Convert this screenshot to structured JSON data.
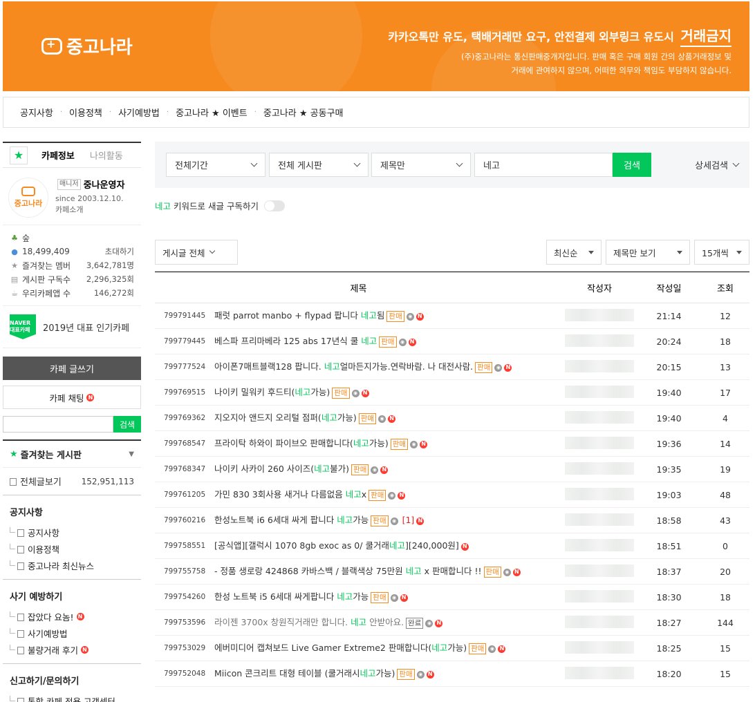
{
  "banner": {
    "logo": "중고나라",
    "warning_prefix": "카카오톡만 유도, 택배거래만 요구, 안전결제 외부링크 유도시",
    "warning_strong": "거래금지",
    "notice_line1": "(주)중고나라는 통신판매중개자입니다. 판매 혹은 구매 회원 간의 상품거래정보 및",
    "notice_line2": "거래에 관여하지 않으며, 어떠한 의무와 책임도 부담하지 않습니다."
  },
  "toplinks": [
    "공지사항",
    "이용정책",
    "사기예방법",
    "중고나라 ★ 이벤트",
    "중고나라 ★ 공동구매"
  ],
  "sidebar": {
    "tab_info": "카페정보",
    "tab_activity": "나의활동",
    "manager_tag": "매니저",
    "manager_name": "중나운영자",
    "since": "since 2003.12.10.",
    "intro": "카페소개",
    "profile_logo": "중고나라",
    "level": "숲",
    "members": "18,499,409",
    "invite": "초대하기",
    "stats": [
      {
        "label": "즐겨찾는 멤버",
        "value": "3,642,781명"
      },
      {
        "label": "게시판 구독수",
        "value": "2,296,325회"
      },
      {
        "label": "우리카페앱 수",
        "value": "146,272회"
      }
    ],
    "award_badge": "NAVER 대표카페",
    "award_text": "2019년 대표 인기카페",
    "write": "카페 글쓰기",
    "chat": "카페 채팅",
    "search_btn": "검색",
    "fav_boards": "즐겨찾는 게시판",
    "all_posts": "전체글보기",
    "all_posts_count": "152,951,113",
    "groups": [
      {
        "title": "공지사항",
        "items": [
          {
            "label": "공지사항",
            "new": false
          },
          {
            "label": "이용정책",
            "new": false
          },
          {
            "label": "중고나라 최신뉴스",
            "new": false
          }
        ]
      },
      {
        "title": "사기 예방하기",
        "items": [
          {
            "label": "잡았다 요놈!",
            "new": true
          },
          {
            "label": "사기예방법",
            "new": false
          },
          {
            "label": "불량거래 후기",
            "new": true
          }
        ]
      },
      {
        "title": "신고하기/문의하기",
        "items": [
          {
            "label": "통합 카페 전용 고객센터",
            "new": false
          }
        ]
      }
    ]
  },
  "search": {
    "period": "전체기간",
    "board": "전체 게시판",
    "scope": "제목만",
    "keyword": "네고",
    "button": "검색",
    "advanced": "상세검색",
    "subscribe_keyword": "네고",
    "subscribe_text": "키워드로 새글 구독하기"
  },
  "filters": {
    "post_type": "게시글 전체",
    "sort": "최신순",
    "view": "제목만 보기",
    "per_page": "15개씩"
  },
  "table": {
    "headers": {
      "title": "제목",
      "author": "작성자",
      "date": "작성일",
      "views": "조회"
    },
    "rows": [
      {
        "id": "799791445",
        "pre": "패럿 parrot manbo + flypad 팝니다 ",
        "hl": "네고",
        "post": "됨",
        "tag": "판매",
        "done": false,
        "comments": "",
        "cam": true,
        "new": true,
        "date": "21:14",
        "views": "12",
        "dim": false
      },
      {
        "id": "799779445",
        "pre": "베스파 프리마베라 125 abs 17년식 쿨 ",
        "hl": "네고",
        "post": "",
        "tag": "판매",
        "done": false,
        "comments": "",
        "cam": true,
        "new": true,
        "date": "20:24",
        "views": "18",
        "dim": false
      },
      {
        "id": "799777524",
        "pre": "아이폰7매트블랙128 팝니다. ",
        "hl": "네고",
        "post": "얼마든지가능.연락바람. 나 대전사람.",
        "tag": "판매",
        "done": false,
        "comments": "",
        "cam": true,
        "new": true,
        "date": "20:15",
        "views": "13",
        "dim": false
      },
      {
        "id": "799769515",
        "pre": "나이키 밀워키 후드티(",
        "hl": "네고",
        "post": "가능)",
        "tag": "판매",
        "done": false,
        "comments": "",
        "cam": true,
        "new": true,
        "date": "19:40",
        "views": "17",
        "dim": false
      },
      {
        "id": "799769362",
        "pre": "지오지아 앤드지 오리털 점퍼(",
        "hl": "네고",
        "post": "가능)",
        "tag": "판매",
        "done": false,
        "comments": "",
        "cam": true,
        "new": true,
        "date": "19:40",
        "views": "4",
        "dim": false
      },
      {
        "id": "799768547",
        "pre": "프라이탁 하와이 파이브오 판매합니다(",
        "hl": "네고",
        "post": "가능)",
        "tag": "판매",
        "done": false,
        "comments": "",
        "cam": true,
        "new": true,
        "date": "19:36",
        "views": "14",
        "dim": false
      },
      {
        "id": "799768347",
        "pre": "나이키 사카이 260 사이즈(",
        "hl": "네고",
        "post": "불가)",
        "tag": "판매",
        "done": false,
        "comments": "",
        "cam": true,
        "new": true,
        "date": "19:35",
        "views": "19",
        "dim": false
      },
      {
        "id": "799761205",
        "pre": "가민 830 3회사용 새거나 다름없음 ",
        "hl": "네고",
        "post": "x",
        "tag": "판매",
        "done": false,
        "comments": "",
        "cam": true,
        "new": true,
        "date": "19:03",
        "views": "48",
        "dim": false
      },
      {
        "id": "799760216",
        "pre": "한성노트북 i6 6세대 싸게 팝니다 ",
        "hl": "네고",
        "post": "가능",
        "tag": "판매",
        "done": false,
        "comments": "[1]",
        "cam": true,
        "new": true,
        "date": "18:58",
        "views": "43",
        "dim": false
      },
      {
        "id": "799758551",
        "pre": "[공식앱][갤럭시 1070 8gb exoc as 0/ 쿨거래",
        "hl": "네고",
        "post": "][240,000원]",
        "tag": "",
        "done": false,
        "comments": "",
        "cam": false,
        "new": true,
        "date": "18:51",
        "views": "0",
        "dim": false
      },
      {
        "id": "799755758",
        "pre": "- 정품 생로랑 424868 카바스백 / 블랙색상 75만원 ",
        "hl": "네고",
        "post": " x 판매합니다 !!",
        "tag": "판매",
        "done": false,
        "comments": "",
        "cam": true,
        "new": true,
        "date": "18:37",
        "views": "20",
        "dim": false
      },
      {
        "id": "799754260",
        "pre": "한성 노트북 i5 6세대 싸게팝니다 ",
        "hl": "네고",
        "post": "가능",
        "tag": "판매",
        "done": false,
        "comments": "",
        "cam": true,
        "new": true,
        "date": "18:30",
        "views": "18",
        "dim": false
      },
      {
        "id": "799753596",
        "pre": "라이젠 3700x 창원직거래만 합니다. ",
        "hl": "네고",
        "post": " 안받아요.",
        "tag": "완료",
        "done": true,
        "comments": "",
        "cam": true,
        "new": true,
        "date": "18:27",
        "views": "144",
        "dim": true
      },
      {
        "id": "799753029",
        "pre": "에버미디어 캡쳐보드 Live Gamer Extreme2 판매합니다(",
        "hl": "네고",
        "post": "가능)",
        "tag": "판매",
        "done": false,
        "comments": "",
        "cam": true,
        "new": true,
        "date": "18:25",
        "views": "15",
        "dim": false
      },
      {
        "id": "799752048",
        "pre": "Miicon 콘크리트 대형 테이블 (쿨거래시",
        "hl": "네고",
        "post": "가능)",
        "tag": "판매",
        "done": false,
        "comments": "",
        "cam": true,
        "new": true,
        "date": "18:20",
        "views": "15",
        "dim": false
      }
    ]
  },
  "colors": {
    "brand_orange": "#f68a1f",
    "naver_green": "#03c75a",
    "new_red": "#ff3b30"
  }
}
